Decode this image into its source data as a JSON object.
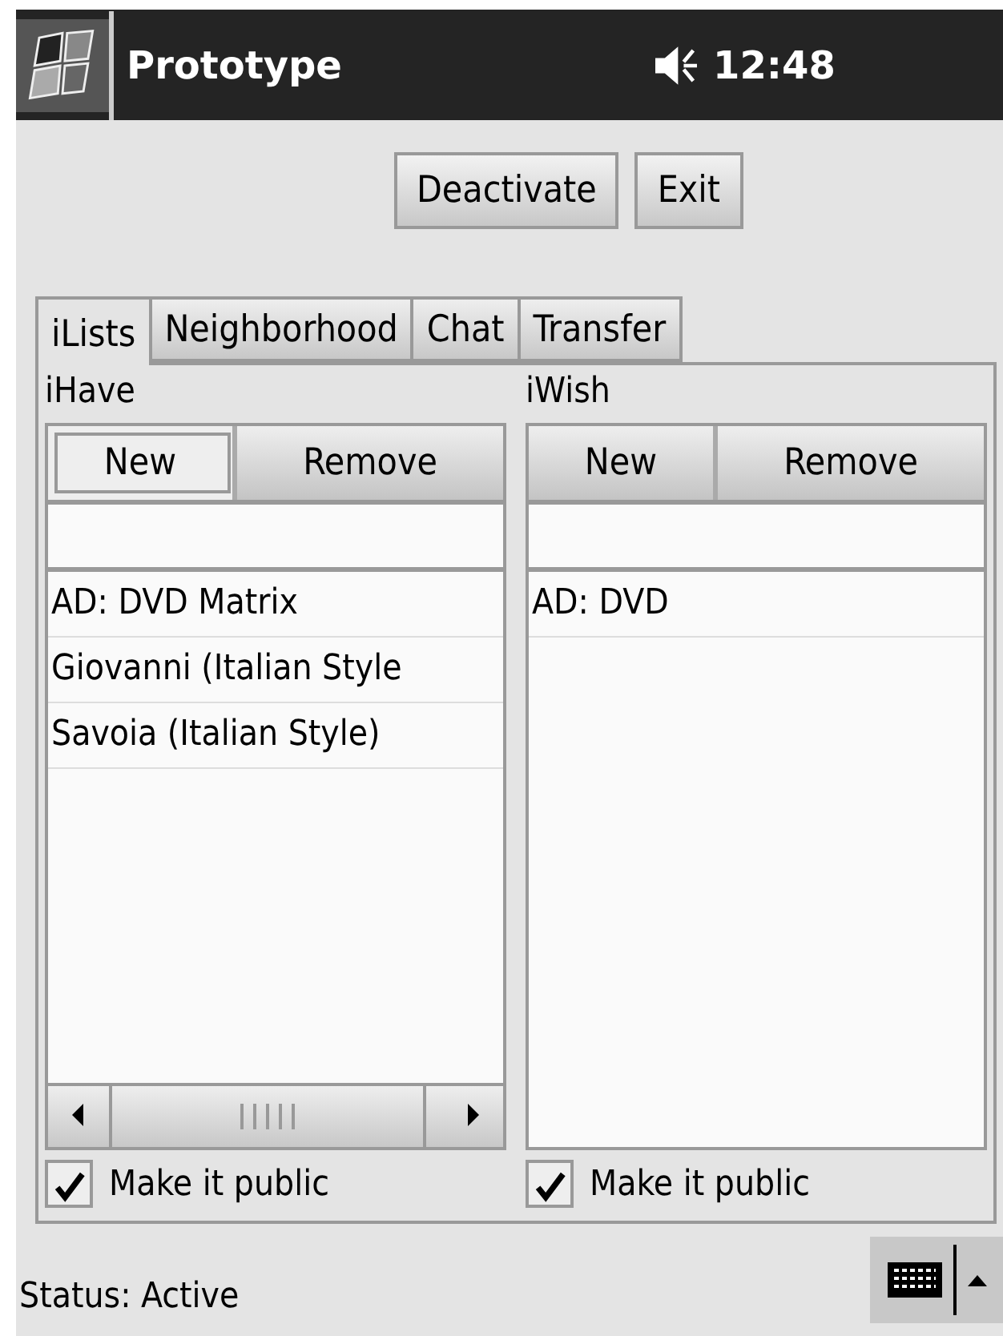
{
  "title_bar": {
    "title": "Prototype",
    "time": "12:48",
    "muted": false
  },
  "toolbar_buttons": [
    "Deactivate",
    "Exit"
  ],
  "tabs": [
    {
      "label": "iLists",
      "selected": true
    },
    {
      "label": "Neighborhood",
      "selected": false
    },
    {
      "label": "Chat",
      "selected": false
    },
    {
      "label": "Transfer",
      "selected": false
    }
  ],
  "lists": [
    {
      "heading": "iHave",
      "buttons": [
        {
          "label": "New",
          "focused": true
        },
        {
          "label": "Remove",
          "focused": false
        }
      ],
      "items": [
        "AD: DVD Matrix",
        "Giovanni (Italian Style",
        "Savoia (Italian Style)"
      ],
      "horizontal_scrollbar": true,
      "public": {
        "label": "Make it public",
        "checked": true
      }
    },
    {
      "heading": "iWish",
      "buttons": [
        {
          "label": "New",
          "focused": false
        },
        {
          "label": "Remove",
          "focused": false
        }
      ],
      "items": [
        "AD: DVD"
      ],
      "horizontal_scrollbar": false,
      "public": {
        "label": "Make it public",
        "checked": true
      }
    }
  ],
  "status": "Status: Active"
}
